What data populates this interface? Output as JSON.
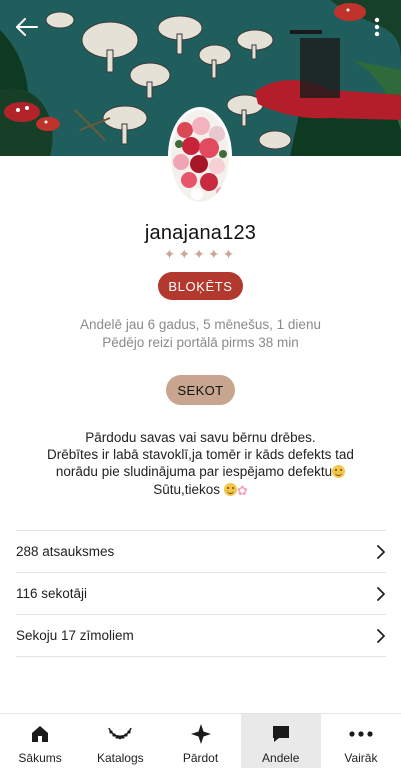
{
  "profile": {
    "username": "janajana123",
    "rating_stars": "✦✦✦✦✦",
    "badge": "BLOĶĒTS",
    "member_since": "Andelē jau 6 gadus, 5 mēnešus, 1 dienu",
    "last_seen": "Pēdējo reizi portālā pirms 38 min",
    "follow_label": "SEKOT",
    "bio_line1": "Pārdodu savas vai savu bērnu drēbes.",
    "bio_line2": "Drēbītes ir labā stavoklī,ja tomēr ir kāds defekts tad",
    "bio_line3": "norādu pie sludinājuma par iespējamo defektu",
    "bio_line4": "Sūtu,tiekos"
  },
  "links": [
    {
      "label": "288 atsauksmes"
    },
    {
      "label": "116 sekotāji"
    },
    {
      "label": "Sekoju 17 zīmoliem"
    }
  ],
  "tabbar": {
    "tabs": [
      {
        "label": "Sākums",
        "icon": "home-icon"
      },
      {
        "label": "Katalogs",
        "icon": "necklace-icon"
      },
      {
        "label": "Pārdot",
        "icon": "sparkle-icon"
      },
      {
        "label": "Andele",
        "icon": "chat-icon"
      },
      {
        "label": "Vairāk",
        "icon": "more-icon"
      }
    ],
    "active": "Andele"
  },
  "colors": {
    "badge": "#b3382d",
    "follow_button": "#c7a58f",
    "stars": "#c9a898",
    "cover": "#1f5e5c"
  }
}
